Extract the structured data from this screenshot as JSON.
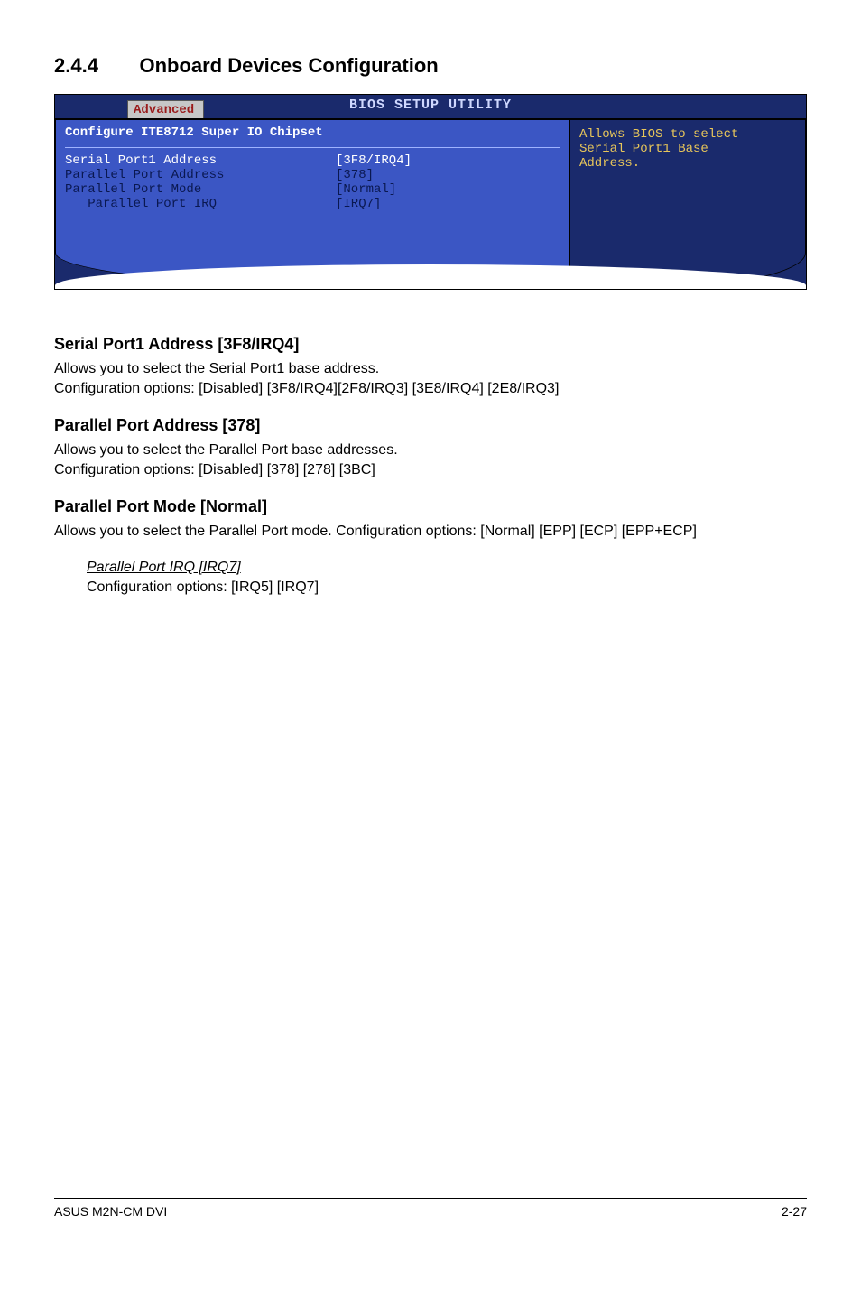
{
  "section": {
    "number": "2.4.4",
    "title": "Onboard Devices Configuration"
  },
  "bios": {
    "title": "BIOS SETUP UTILITY",
    "tab": "Advanced",
    "panel_heading": "Configure ITE8712 Super IO Chipset",
    "rows": [
      {
        "label": "Serial Port1 Address",
        "value": "[3F8/IRQ4]",
        "selected": true,
        "indent": 0
      },
      {
        "label": "Parallel Port Address",
        "value": "[378]",
        "selected": false,
        "indent": 0
      },
      {
        "label": "Parallel Port Mode",
        "value": "[Normal]",
        "selected": false,
        "indent": 0
      },
      {
        "label": "Parallel Port IRQ",
        "value": "[IRQ7]",
        "selected": false,
        "indent": 1
      }
    ],
    "help": "Allows BIOS to select\nSerial Port1 Base\nAddress."
  },
  "doc": {
    "s1": {
      "h": "Serial Port1 Address [3F8/IRQ4]",
      "p": "Allows you to select the Serial Port1 base address.\nConfiguration options: [Disabled] [3F8/IRQ4][2F8/IRQ3] [3E8/IRQ4] [2E8/IRQ3]"
    },
    "s2": {
      "h": "Parallel Port Address [378]",
      "p": "Allows you to select the Parallel Port base addresses.\nConfiguration options: [Disabled] [378] [278] [3BC]"
    },
    "s3": {
      "h": "Parallel Port Mode [Normal]",
      "p": "Allows you to select the Parallel Port  mode. Configuration options: [Normal] [EPP] [ECP] [EPP+ECP]"
    },
    "sub_item": {
      "title": "Parallel Port IRQ [IRQ7]",
      "body": "Configuration options: [IRQ5] [IRQ7]"
    }
  },
  "footer": {
    "left": "ASUS M2N-CM DVI",
    "right": "2-27"
  }
}
